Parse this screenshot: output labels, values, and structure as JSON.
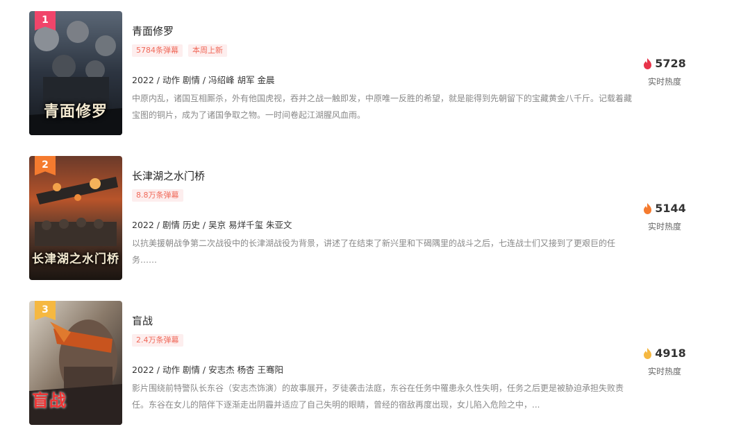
{
  "heat_label": "实时热度",
  "items": [
    {
      "rank": "1",
      "rank_color": "#f0456a",
      "poster_text": "青面修罗",
      "title": "青面修罗",
      "tags": [
        "5784条弹幕",
        "本周上新"
      ],
      "meta": "2022 / 动作 剧情 / 冯绍峰 胡军 金晨",
      "desc": "中原内乱，诸国互相厮杀，外有他国虎视，吞并之战一触即发，中原唯一反胜的希望，就是能得到先朝留下的宝藏黄金八千斤。记载着藏宝图的铜片，成为了诸国争取之物。一时间卷起江湖腥风血雨。",
      "heat": "5728",
      "flame_color": "#e8334a"
    },
    {
      "rank": "2",
      "rank_color": "#f57b2f",
      "poster_text": "长津湖之水门桥",
      "title": "长津湖之水门桥",
      "tags": [
        "8.8万条弹幕"
      ],
      "meta": "2022 / 剧情 历史 / 吴京 易烊千玺 朱亚文",
      "desc": "以抗美援朝战争第二次战役中的长津湖战役为背景，讲述了在结束了新兴里和下碣隅里的战斗之后，七连战士们又接到了更艰巨的任务……",
      "heat": "5144",
      "flame_color": "#f57b2f"
    },
    {
      "rank": "3",
      "rank_color": "#f5b841",
      "poster_text": "盲战",
      "title": "盲战",
      "tags": [
        "2.4万条弹幕"
      ],
      "meta": "2022 / 动作 剧情 / 安志杰 杨杏 王骞阳",
      "desc": "影片围绕前特警队长东谷（安志杰饰演）的故事展开，歹徒袭击法庭，东谷在任务中罹患永久性失明，任务之后更是被胁迫承担失败责任。东谷在女儿的陪伴下逐渐走出阴霾并适应了自己失明的眼睛，曾经的宿敌再度出现，女儿陷入危险之中，...",
      "heat": "4918",
      "flame_color": "#f5b841"
    }
  ]
}
